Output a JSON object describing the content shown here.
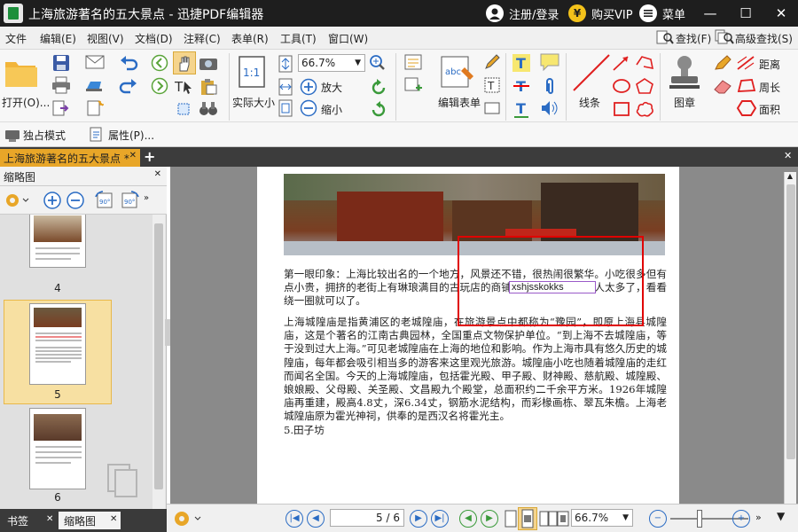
{
  "window": {
    "title": "上海旅游著名的五大景点 - 迅捷PDF编辑器",
    "register_login": "注册/登录",
    "buy_vip": "购买VIP",
    "menu": "菜单",
    "minimize": "—",
    "maximize": "☐",
    "close": "✕"
  },
  "menubar": {
    "items": [
      "文件",
      "编辑(E)",
      "视图(V)",
      "文档(D)",
      "注释(C)",
      "表单(R)",
      "工具(T)",
      "窗口(W)"
    ],
    "find": "查找(F)",
    "advanced_find": "高级查找(S)"
  },
  "ribbon": {
    "open": "打开(O)...",
    "actual_size": "实际大小",
    "zoom_value": "66.7%",
    "zoom_in": "放大",
    "zoom_out": "缩小",
    "edit_form": "编辑表单",
    "line": "线条",
    "stamp": "图章",
    "distance": "距离",
    "perimeter": "周长",
    "area": "面积",
    "exclusive_mode": "独占模式",
    "properties": "属性(P)..."
  },
  "doc_tab": {
    "label": "上海旅游著名的五大景点 *",
    "close": "✕",
    "add": "+"
  },
  "left_panel": {
    "title": "缩略图",
    "close": "✕",
    "pages": [
      "4",
      "5",
      "6"
    ],
    "tab_bookmarks": "书签",
    "tab_thumbnails": "缩略图"
  },
  "document": {
    "paragraph1": "第一眼印象：上海比较出名的一个地方，风景还不错，很热闹很繁华。小吃很多但有点小贵，拥挤的老街上有琳琅满目的古玩店的商铺很多。但是节假日人太多了，看看绕一圈就可以了。",
    "paragraph2": "上海城隍庙是指黄浦区的老城隍庙，在旅游景点中都称为“豫园”，即原上海县城隍庙，这是个著名的江南古典园林，全国重点文物保护单位。“到上海不去城隍庙，等于没到过大上海。”可见老城隍庙在上海的地位和影响。作为上海市具有悠久历史的城隍庙，每年都会吸引相当多的游客来这里观光旅游。城隍庙小吃也随着城隍庙的走红而闻名全国。今天的上海城隍庙，包括霍光殿、甲子殿、财神殿、慈航殿、城隍殿、娘娘殿、父母殿、关圣殿、文昌殿九个殿堂，总面积约二千余平方米。1926年城隍庙再重建，殿高4.8丈，深6.34丈，钢筋水泥结构，而彩椽画栋、翠瓦朱檐。上海老城隍庙原为霍光神祠，供奉的是西汉名将霍光主。",
    "heading": "5.田子坊",
    "text_field_value": "xshjsskokks"
  },
  "statusbar": {
    "page_indicator": "5 / 6",
    "zoom_value": "66.7%"
  },
  "colors": {
    "titlebar": "#1e1e1e",
    "doc_tab": "#e8a628",
    "selection_box": "#e00000",
    "form_field_border": "#9a5ac8",
    "accent_blue": "#2b6cc4"
  }
}
